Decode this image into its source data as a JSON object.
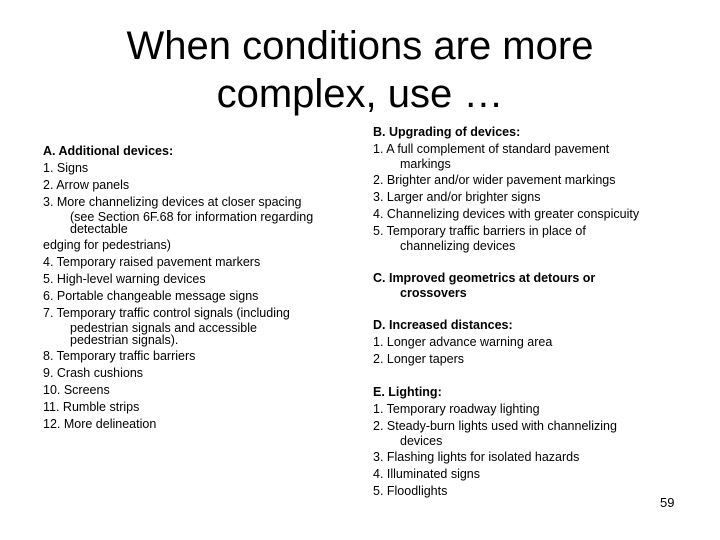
{
  "slide": {
    "title_line1": "When conditions are more",
    "title_line2": "complex, use …",
    "page_number": "59"
  },
  "left": {
    "heading": "A. Additional devices:",
    "items": [
      {
        "text": "1. Signs"
      },
      {
        "text": "2. Arrow panels"
      },
      {
        "text": "3. More channelizing devices at closer spacing",
        "wrap": [
          "(see Section 6F.68 for information regarding",
          "detectable"
        ]
      },
      {
        "text": "edging for pedestrians)"
      },
      {
        "text": "4. Temporary raised pavement markers"
      },
      {
        "text": "5. High-level warning devices"
      },
      {
        "text": "6. Portable changeable message signs"
      },
      {
        "text": "7. Temporary traffic control signals (including",
        "wrap": [
          "pedestrian signals and accessible",
          "pedestrian signals)."
        ]
      },
      {
        "text": "8. Temporary traffic barriers"
      },
      {
        "text": "9. Crash cushions"
      },
      {
        "text": "10. Screens"
      },
      {
        "text": "11. Rumble strips"
      },
      {
        "text": "12. More delineation"
      }
    ]
  },
  "right": {
    "sections": [
      {
        "heading": "B. Upgrading of devices:",
        "items": [
          {
            "text": "1. A full complement of standard pavement",
            "wrap": [
              "markings"
            ]
          },
          {
            "text": "2. Brighter and/or wider pavement markings"
          },
          {
            "text": "3. Larger and/or brighter signs"
          },
          {
            "text": "4. Channelizing devices with greater conspicuity"
          },
          {
            "text": "5. Temporary traffic barriers in place of",
            "wrap": [
              "channelizing devices"
            ]
          }
        ]
      },
      {
        "heading": "C. Improved geometrics at detours or",
        "heading_wrap": "crossovers",
        "items": []
      },
      {
        "heading": "D. Increased distances:",
        "items": [
          {
            "text": "1. Longer advance warning area"
          },
          {
            "text": "2. Longer tapers"
          }
        ]
      },
      {
        "heading": "E. Lighting:",
        "items": [
          {
            "text": "1. Temporary roadway lighting"
          },
          {
            "text": "2. Steady-burn lights used with channelizing",
            "wrap": [
              "devices"
            ]
          },
          {
            "text": "3. Flashing lights for isolated hazards"
          },
          {
            "text": "4. Illuminated signs"
          },
          {
            "text": "5. Floodlights"
          }
        ]
      }
    ]
  }
}
